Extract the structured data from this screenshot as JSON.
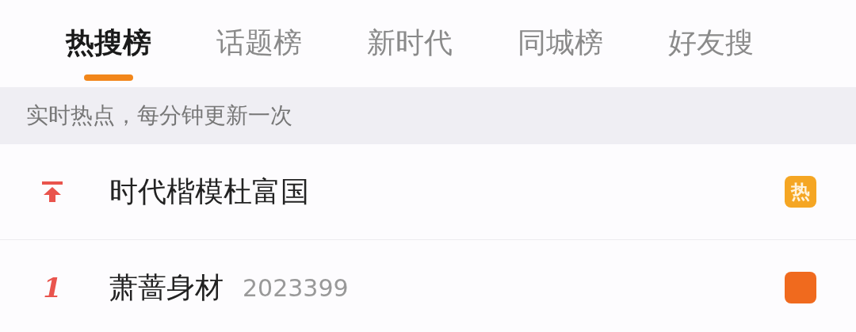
{
  "tabs": [
    {
      "label": "热搜榜",
      "selected": true
    },
    {
      "label": "话题榜",
      "selected": false
    },
    {
      "label": "新时代",
      "selected": false
    },
    {
      "label": "同城榜",
      "selected": false
    },
    {
      "label": "好友搜",
      "selected": false
    }
  ],
  "notice": "实时热点，每分钟更新一次",
  "rows": [
    {
      "kind": "pinned",
      "title": "时代楷模杜富国",
      "badge": {
        "label": "热",
        "color": "#f5a623"
      }
    },
    {
      "kind": "number",
      "rank": "1",
      "title": "萧蔷身材",
      "count": "2023399",
      "badge": {
        "color": "#f06a1e"
      }
    }
  ]
}
